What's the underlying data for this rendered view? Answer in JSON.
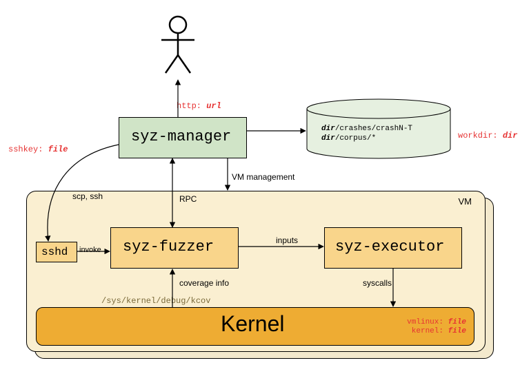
{
  "actor": {
    "label": ""
  },
  "annotations": {
    "http": {
      "key": "http:",
      "val": "url"
    },
    "workdir": {
      "key": "workdir:",
      "val": "dir"
    },
    "sshkey": {
      "key": "sshkey:",
      "val": "file"
    },
    "vmlinux": {
      "key": "vmlinux:",
      "val": "file"
    },
    "kernel": {
      "key": "kernel:",
      "val": "file"
    }
  },
  "nodes": {
    "syz_manager": "syz-manager",
    "sshd": "sshd",
    "syz_fuzzer": "syz-fuzzer",
    "syz_executor": "syz-executor",
    "kernel": "Kernel",
    "vm_label": "VM"
  },
  "storage": {
    "line1_a": "dir",
    "line1_b": "/crashes/crashN-T",
    "line2_a": "dir",
    "line2_b": "/corpus/*"
  },
  "edges": {
    "scp_ssh": "scp, ssh",
    "invoke": "invoke",
    "rpc": "RPC",
    "vm_mgmt": "VM management",
    "inputs": "inputs",
    "coverage": "coverage info",
    "syscalls": "syscalls",
    "kcov_path": "/sys/kernel/debug/kcov"
  }
}
